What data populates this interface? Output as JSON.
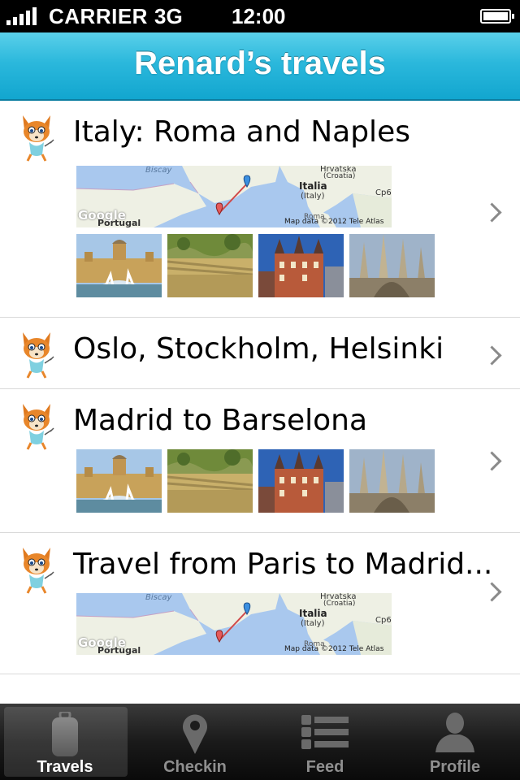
{
  "status_bar": {
    "carrier": "CARRIER",
    "network": "3G",
    "time": "12:00"
  },
  "nav": {
    "title": "Renard’s travels"
  },
  "travels": [
    {
      "title": "Italy: Roma and Naples",
      "map": {
        "labels": [
          "Biscay",
          "Hrvatska",
          "(Croatia)",
          "Italia",
          "(Italy)",
          "Roma",
          "Portugal",
          "Cp6",
          "Google",
          "Map data ©2012 Tele Atlas"
        ]
      },
      "photos": [
        "palace-fountain-photo",
        "park-guell-photo",
        "red-building-photo",
        "sagrada-familia-photo"
      ]
    },
    {
      "title": "Oslo, Stockholm, Helsinki"
    },
    {
      "title": "Madrid to Barselona",
      "photos": [
        "palace-fountain-photo",
        "park-guell-photo",
        "red-building-photo",
        "sagrada-familia-photo"
      ]
    },
    {
      "title": "Travel from Paris to Madrid...",
      "map": {
        "labels": [
          "Biscay",
          "Hrvatska",
          "(Croatia)",
          "Italia",
          "(Italy)",
          "Roma",
          "Portugal",
          "Cp6",
          "Google",
          "Map data ©2012 Tele Atlas"
        ]
      }
    }
  ],
  "tabs": [
    {
      "label": "Travels",
      "icon": "luggage-icon",
      "active": true
    },
    {
      "label": "Checkin",
      "icon": "map-pin-icon",
      "active": false
    },
    {
      "label": "Feed",
      "icon": "list-icon",
      "active": false
    },
    {
      "label": "Profile",
      "icon": "person-icon",
      "active": false
    }
  ],
  "colors": {
    "nav_top": "#5ad0ea",
    "nav_bottom": "#12a6cf",
    "tab_bar": "#1a1a1a"
  }
}
